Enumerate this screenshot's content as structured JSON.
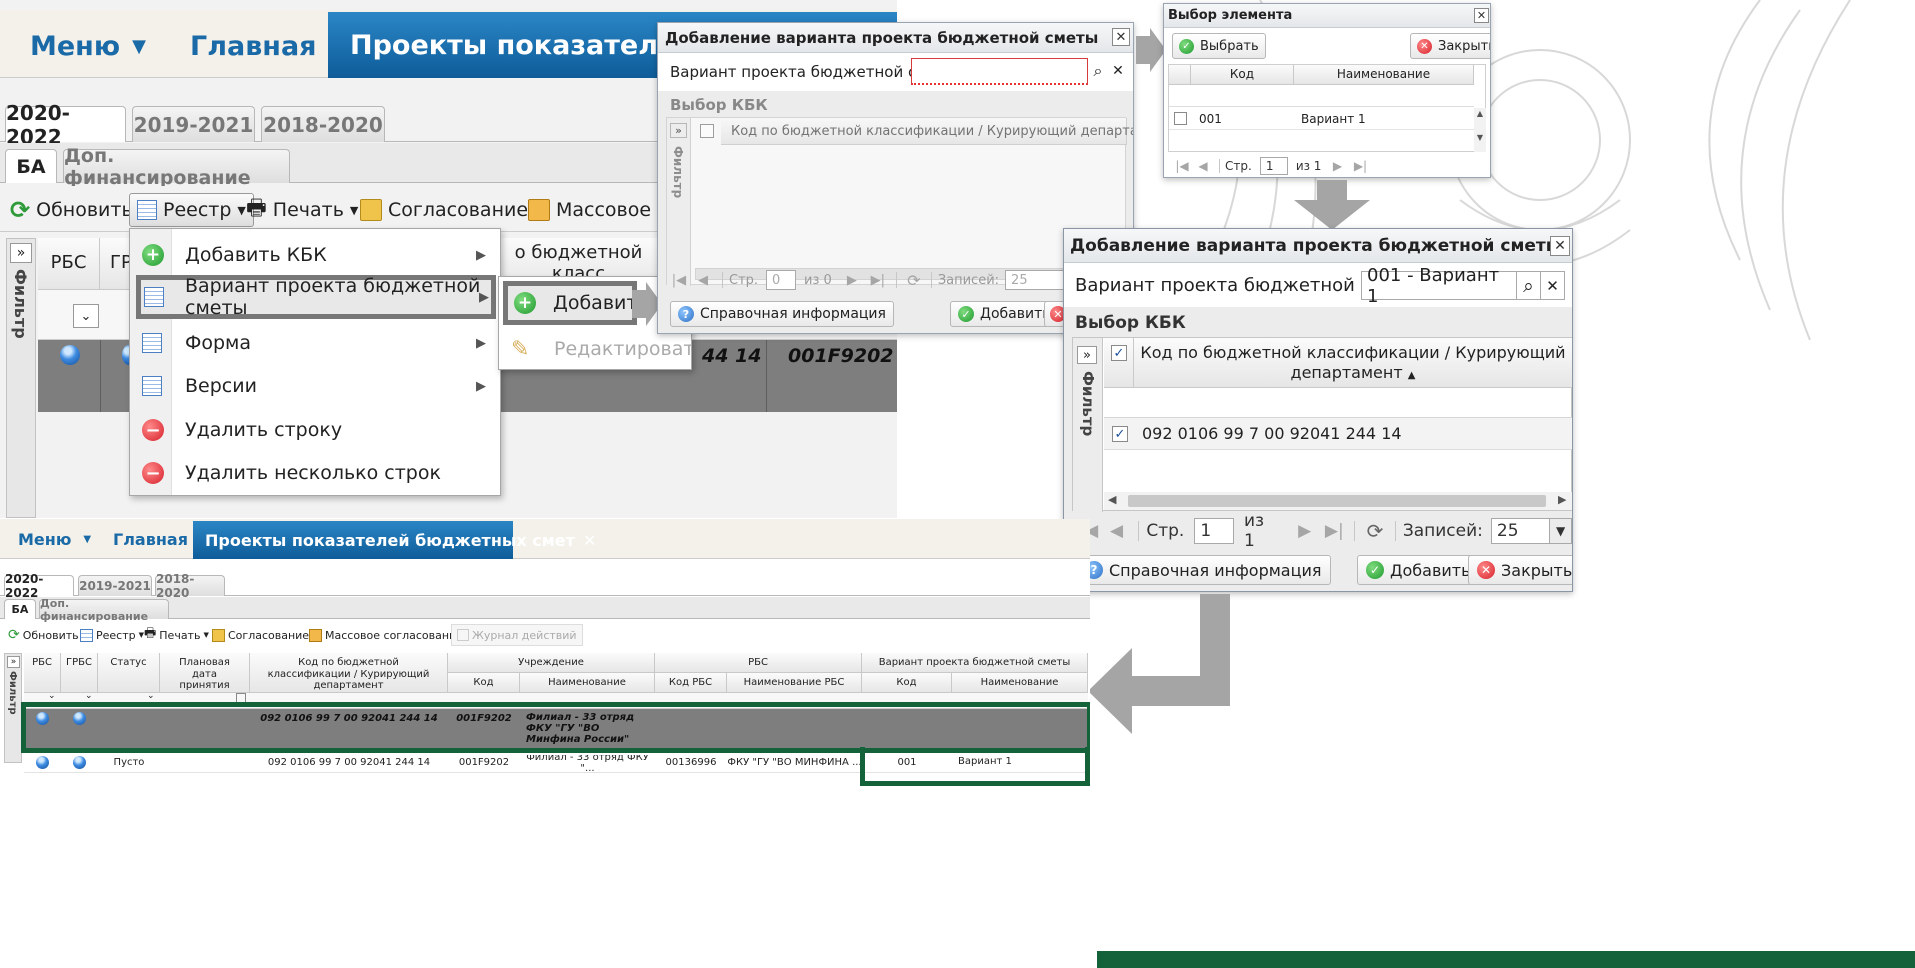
{
  "colors": {
    "brand_blue": "#1a6aa8",
    "dark_green": "#14623a",
    "row_dark": "#7e7e7e",
    "arrow_grey": "#a5a5a5",
    "error_red": "#e63232"
  },
  "top_app": {
    "menu_label": "Меню",
    "home_label": "Главная",
    "active_tab": "Проекты показателей бюджетных смет",
    "active_tab_visible": "Проекты показателей бюдж",
    "year_tabs": [
      "2020-2022",
      "2019-2021",
      "2018-2020"
    ],
    "sub_tabs": [
      "БА",
      "Доп. финансирование"
    ],
    "toolbar": {
      "refresh": "Обновить",
      "registry": "Реестр",
      "print": "Печать",
      "approval": "Согласование",
      "mass_approval": "Массовое со"
    },
    "filter_label": "Фильтр",
    "col_rbs": "РБС",
    "col_grbs": "ГР",
    "col_code_top": "о бюджетной класс",
    "row_code": "44 14",
    "row_inst": "001F9202"
  },
  "registry_menu": {
    "items": [
      {
        "label": "Добавить КБК",
        "icon": "add-icon",
        "submenu": true
      },
      {
        "label": "Вариант проекта бюджетной сметы",
        "icon": "table-icon",
        "submenu": true
      },
      {
        "label": "Форма",
        "icon": "table-icon",
        "submenu": true
      },
      {
        "label": "Версии",
        "icon": "table-icon",
        "submenu": true
      },
      {
        "label": "Удалить строку",
        "icon": "delete-icon",
        "submenu": false
      },
      {
        "label": "Удалить несколько строк",
        "icon": "delete-icon",
        "submenu": false
      }
    ],
    "submenu": [
      {
        "label": "Добавить",
        "icon": "add-icon",
        "enabled": true
      },
      {
        "label": "Редактировать",
        "icon": "edit-icon",
        "enabled": false
      }
    ]
  },
  "dialog1": {
    "title": "Добавление варианта проекта бюджетной сметы",
    "field_label": "Вариант проекта бюджетной сметы:",
    "field_value": "",
    "section": "Выбор КБК",
    "col_header": "Код по бюджетной классификации / Курирующий департамент",
    "filter_label": "Фильтр",
    "pager": {
      "page_label": "Стр.",
      "page": "0",
      "of": "из 0",
      "records_label": "Записей:",
      "records": "25"
    },
    "help": "Справочная информация",
    "add": "Добавить"
  },
  "picker": {
    "title": "Выбор элемента",
    "select_btn": "Выбрать",
    "close_btn": "Закрыть",
    "cols": [
      "Код",
      "Наименование"
    ],
    "rows": [
      {
        "code": "001",
        "name": "Вариант 1"
      }
    ],
    "pager": {
      "page_label": "Стр.",
      "page": "1",
      "of": "из 1"
    }
  },
  "dialog2": {
    "title": "Добавление варианта проекта бюджетной сметы",
    "field_label": "Вариант проекта бюджетной сметы:",
    "field_value": "001 - Вариант 1",
    "section": "Выбор КБК",
    "col_header_1": "Код по бюджетной классификации / Курирующий",
    "col_header_2": "департамент",
    "filter_label": "Фильтр",
    "row": "092 0106 99 7 00 92041 244 14",
    "pager": {
      "page_label": "Стр.",
      "page": "1",
      "of": "из 1",
      "records_label": "Записей:",
      "records": "25"
    },
    "help": "Справочная информация",
    "add": "Добавить",
    "close": "Закрыть"
  },
  "bottom_app": {
    "menu_label": "Меню",
    "home_label": "Главная",
    "active_tab": "Проекты показателей бюджетных смет",
    "year_tabs": [
      "2020-2022",
      "2019-2021",
      "2018-2020"
    ],
    "sub_tabs": [
      "БА",
      "Доп. финансирование"
    ],
    "toolbar": {
      "refresh": "Обновить",
      "registry": "Реестр",
      "print": "Печать",
      "approval": "Согласование",
      "mass_approval": "Массовое согласование",
      "journal": "Журнал действий"
    },
    "filter_label": "Фильтр",
    "headers": {
      "rbs": "РБС",
      "grbs": "ГРБС",
      "status": "Статус",
      "plan_date": "Плановая дата принятия ОПСП",
      "kbk": "Код по бюджетной классификации / Курирующий департамент",
      "inst": "Учреждение",
      "inst_code": "Код",
      "inst_name": "Наименование",
      "rbs_group": "РБС",
      "rbs_code": "Код РБС",
      "rbs_name": "Наименование РБС",
      "variant": "Вариант проекта бюджетной сметы",
      "var_code": "Код",
      "var_name": "Наименование"
    },
    "row1": {
      "kbk": "092 0106 99 7 00 92041 244 14",
      "inst_code": "001F9202",
      "inst_name": "Филиал - 33 отряд ФКУ \"ГУ \"ВО Минфина России\""
    },
    "row2": {
      "status": "Пусто",
      "kbk": "092 0106 99 7 00 92041 244 14",
      "inst_code": "001F9202",
      "inst_name": "Филиал - 33 отряд ФКУ \"...",
      "rbs_code": "00136996",
      "rbs_name": "ФКУ \"ГУ \"ВО МИНФИНА ...",
      "var_code": "001",
      "var_name": "Вариант 1"
    }
  }
}
